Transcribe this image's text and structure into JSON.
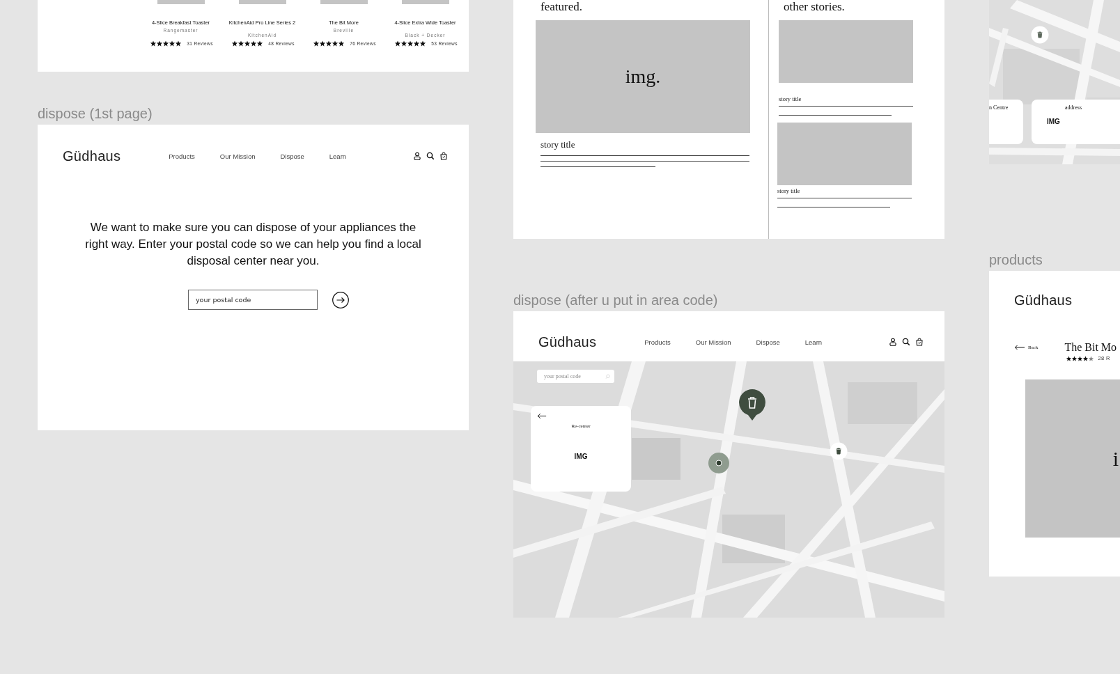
{
  "product_strip": {
    "products": [
      {
        "name": "4-Slice Breakfast Toaster",
        "brand": "Rangemaster",
        "stars": 5,
        "reviews": "31 Reviews"
      },
      {
        "name": "KitchenAid Pro Line Series 2",
        "brand": "KitchenAid",
        "stars": 5,
        "reviews": "48 Reviews"
      },
      {
        "name": "The Bit More",
        "brand": "Breville",
        "stars": 5,
        "reviews": "76 Reviews"
      },
      {
        "name": "4-Slice Extra Wide Toaster",
        "brand": "Black + Decker",
        "stars": 5,
        "reviews": "53 Reviews"
      }
    ]
  },
  "dispose_first": {
    "label": "dispose (1st page)",
    "logo": "Güdhaus",
    "nav": [
      "Products",
      "Our Mission",
      "Dispose",
      "Learn"
    ],
    "message": "We want to make sure you can dispose of your appliances the right way. Enter your postal code so we can help you find a local disposal center near you.",
    "postal_field": {
      "placeholder": "your postal code"
    }
  },
  "stories": {
    "featured_heading": "featured.",
    "featured": {
      "image_label": "img.",
      "title": "story title"
    },
    "other_heading": "other stories.",
    "others": [
      {
        "title": "story title"
      },
      {
        "title": "story title"
      }
    ]
  },
  "dispose_map": {
    "label": "dispose (after u put in area code)",
    "logo": "Güdhaus",
    "nav": [
      "Products",
      "Our Mission",
      "Dispose",
      "Learn"
    ],
    "search": {
      "placeholder": "your postal code"
    },
    "card": {
      "action": "Re-center",
      "image_label": "IMG"
    }
  },
  "map_detail": {
    "cards": [
      {
        "title": "n Centre"
      },
      {
        "title": "address",
        "image_label": "IMG"
      }
    ]
  },
  "product_detail": {
    "label": "products",
    "logo": "Güdhaus",
    "back": "Back",
    "title": "The Bit Mo",
    "stars": 4,
    "reviews": "28 R",
    "image_label": "i"
  }
}
